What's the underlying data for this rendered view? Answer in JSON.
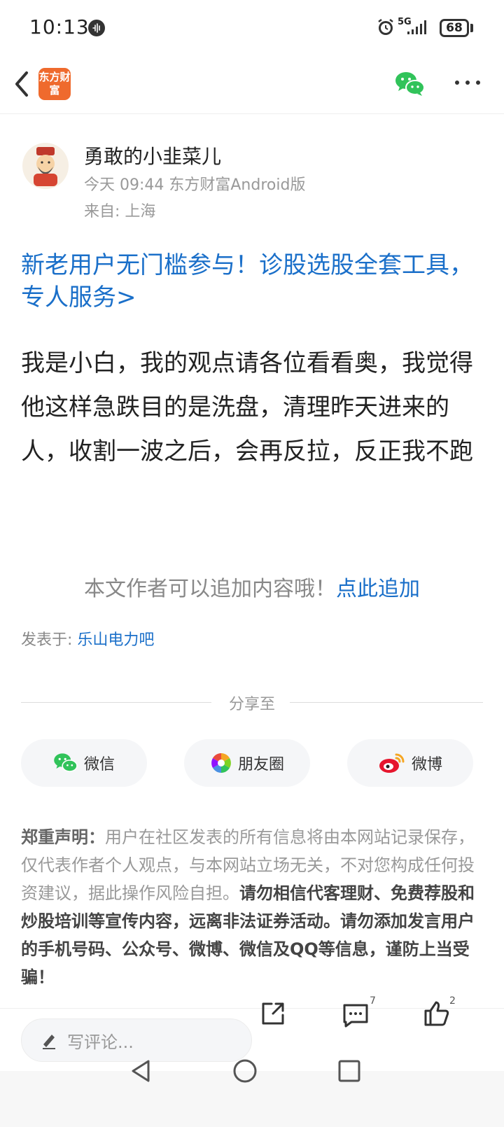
{
  "status_bar": {
    "time": "10:13",
    "network": "5G",
    "battery": "68"
  },
  "header": {
    "app_logo_text": "东方财富"
  },
  "post": {
    "author": "勇敢的小韭菜儿",
    "meta_time_source": "今天 09:44 东方财富Android版",
    "location": "来自: 上海",
    "promo_link": "新老用户无门槛参与！诊股选股全套工具，专人服务>",
    "content": "我是小白，我的观点请各位看看奥，我觉得他这样急跌目的是洗盘，清理昨天进来的人，收割一波之后，会再反拉，反正我不跑"
  },
  "append": {
    "text": "本文作者可以追加内容哦！",
    "link": "点此追加"
  },
  "posted_in": {
    "label": "发表于: ",
    "forum": "乐山电力吧"
  },
  "share": {
    "title": "分享至",
    "buttons": [
      "微信",
      "朋友圈",
      "微博"
    ]
  },
  "disclaimer": {
    "lead": "郑重声明：",
    "normal": "用户在社区发表的所有信息将由本网站记录保存，仅代表作者个人观点，与本网站立场无关，不对您构成任何投资建议，据此操作风险自担。",
    "strong": "请勿相信代客理财、免费荐股和炒股培训等宣传内容，远离非法证券活动。请勿添加发言用户的手机号码、公众号、微博、微信及QQ等信息，谨防上当受骗！"
  },
  "bottom": {
    "comment_placeholder": "写评论...",
    "comment_count": "7",
    "like_count": "2"
  },
  "colors": {
    "link": "#1a6fc9",
    "brand": "#ef6a2d",
    "wechat": "#31c35a"
  }
}
